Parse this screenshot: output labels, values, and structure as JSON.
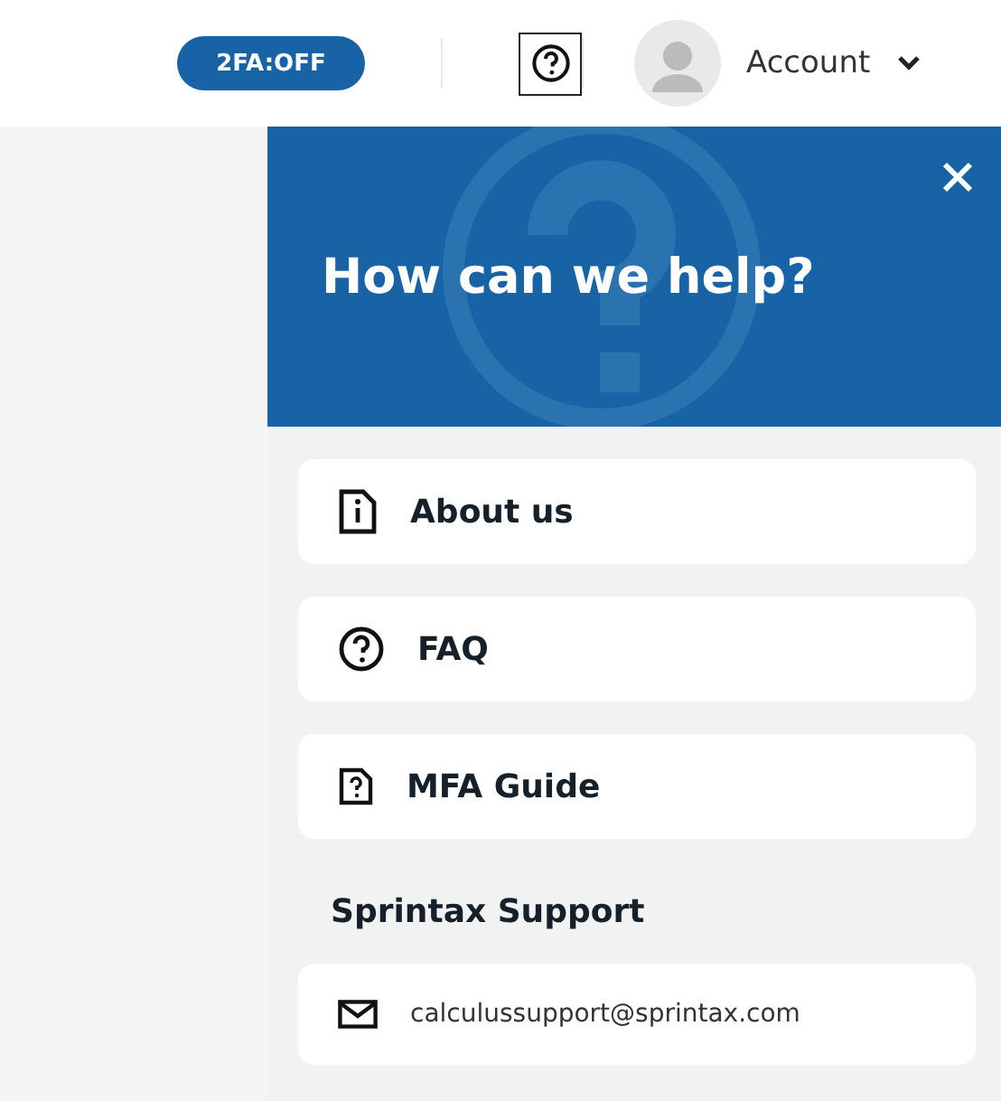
{
  "header": {
    "twofa_badge": "2FA:OFF",
    "account": {
      "label": "Account"
    }
  },
  "help_panel": {
    "title": "How can we help?",
    "items": [
      {
        "kind": "info",
        "label": "About us"
      },
      {
        "kind": "faq",
        "label": "FAQ"
      },
      {
        "kind": "guide",
        "label": "MFA Guide"
      }
    ],
    "support": {
      "heading": "Sprintax Support",
      "email": "calculussupport@sprintax.com"
    }
  }
}
